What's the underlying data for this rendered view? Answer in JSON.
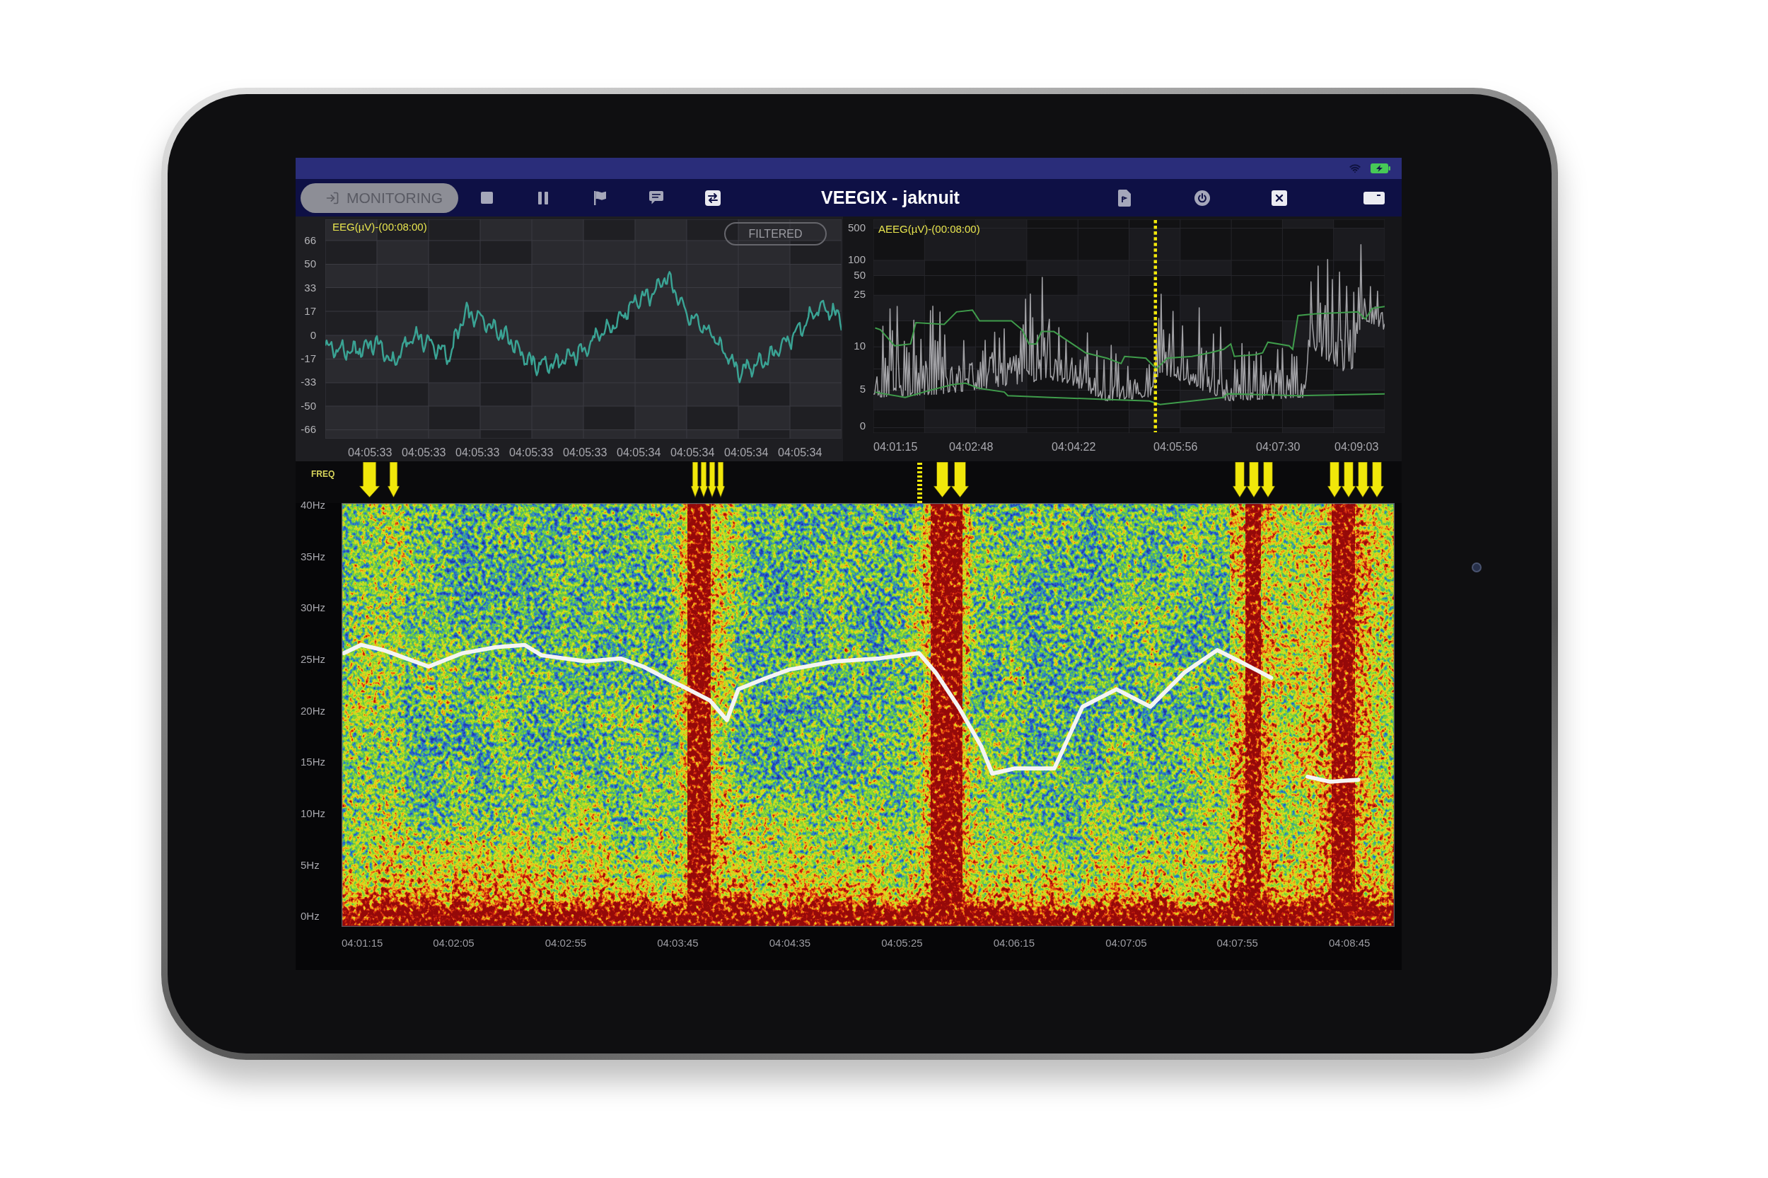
{
  "toolbar": {
    "mode_button": "MONITORING",
    "title": "VEEGIX - jaknuit"
  },
  "eeg_panel": {
    "title": "EEG(µV)-(00:08:00)",
    "filter_button": "FILTERED",
    "y_ticks": [
      "66",
      "50",
      "33",
      "17",
      "0",
      "-17",
      "-33",
      "-50",
      "-66"
    ],
    "x_ticks": [
      "04:05:33",
      "04:05:33",
      "04:05:33",
      "04:05:33",
      "04:05:33",
      "04:05:34",
      "04:05:34",
      "04:05:34",
      "04:05:34"
    ]
  },
  "aeeg_panel": {
    "title": "AEEG(µV)-(00:08:00)",
    "y_ticks": [
      "500",
      "100",
      "50",
      "25",
      "10",
      "5",
      "0"
    ],
    "x_ticks": [
      "04:01:15",
      "04:02:48",
      "04:04:22",
      "04:05:56",
      "04:07:30",
      "04:09:03"
    ]
  },
  "spectrogram_panel": {
    "chart_data": {
      "type": "line",
      "ylabel": "FREQ",
      "color": "#f4f4f4",
      "x": [
        4.0211,
        4.0232,
        4.026,
        4.0288,
        4.0316,
        4.0358,
        4.04,
        4.0435,
        4.0456,
        4.0512,
        4.0554,
        4.0582,
        4.0609,
        4.0638,
        4.0665,
        4.0686,
        4.07,
        4.0735,
        4.0763,
        4.0819,
        4.0875,
        4.0924,
        4.0945,
        4.0973,
        4.1001,
        4.1015,
        4.1043,
        4.1092,
        4.1127,
        4.1169,
        4.1211,
        4.1253,
        4.1294,
        4.1322,
        4.1361,
        4.1383,
        4.1406,
        4.1434,
        4.1469
      ],
      "values": [
        25.6,
        26.4,
        25.9,
        25.1,
        24.3,
        25.6,
        26.2,
        26.4,
        25.4,
        24.8,
        25.1,
        24.3,
        23.2,
        22.1,
        21.0,
        19.1,
        22.1,
        23.2,
        24.0,
        24.8,
        25.1,
        25.6,
        23.7,
        20.4,
        16.6,
        13.9,
        14.4,
        14.4,
        20.4,
        22.1,
        20.4,
        23.7,
        25.9,
        24.8,
        23.2,
        null,
        13.6,
        13.1,
        13.3
      ],
      "xlim": [
        4.0208,
        4.1514
      ],
      "ylim": [
        -1,
        40.2
      ],
      "xticks": [
        {
          "value": 4.0208,
          "label": "04:01:15"
        },
        {
          "value": 4.0347,
          "label": "04:02:05"
        },
        {
          "value": 4.0486,
          "label": "04:02:55"
        },
        {
          "value": 4.0625,
          "label": "04:03:45"
        },
        {
          "value": 4.0764,
          "label": "04:04:35"
        },
        {
          "value": 4.0903,
          "label": "04:05:25"
        },
        {
          "value": 4.1042,
          "label": "04:06:15"
        },
        {
          "value": 4.1181,
          "label": "04:07:05"
        },
        {
          "value": 4.1319,
          "label": "04:07:55"
        },
        {
          "value": 4.1458,
          "label": "04:08:45"
        }
      ],
      "yticks": [
        {
          "value": 40,
          "label": "40Hz"
        },
        {
          "value": 35,
          "label": "35Hz"
        },
        {
          "value": 30,
          "label": "30Hz"
        },
        {
          "value": 25,
          "label": "25Hz"
        },
        {
          "value": 20,
          "label": "20Hz"
        },
        {
          "value": 15,
          "label": "15Hz"
        },
        {
          "value": 10,
          "label": "10Hz"
        },
        {
          "value": 5,
          "label": "5Hz"
        },
        {
          "value": 0,
          "label": "0Hz"
        }
      ]
    }
  }
}
